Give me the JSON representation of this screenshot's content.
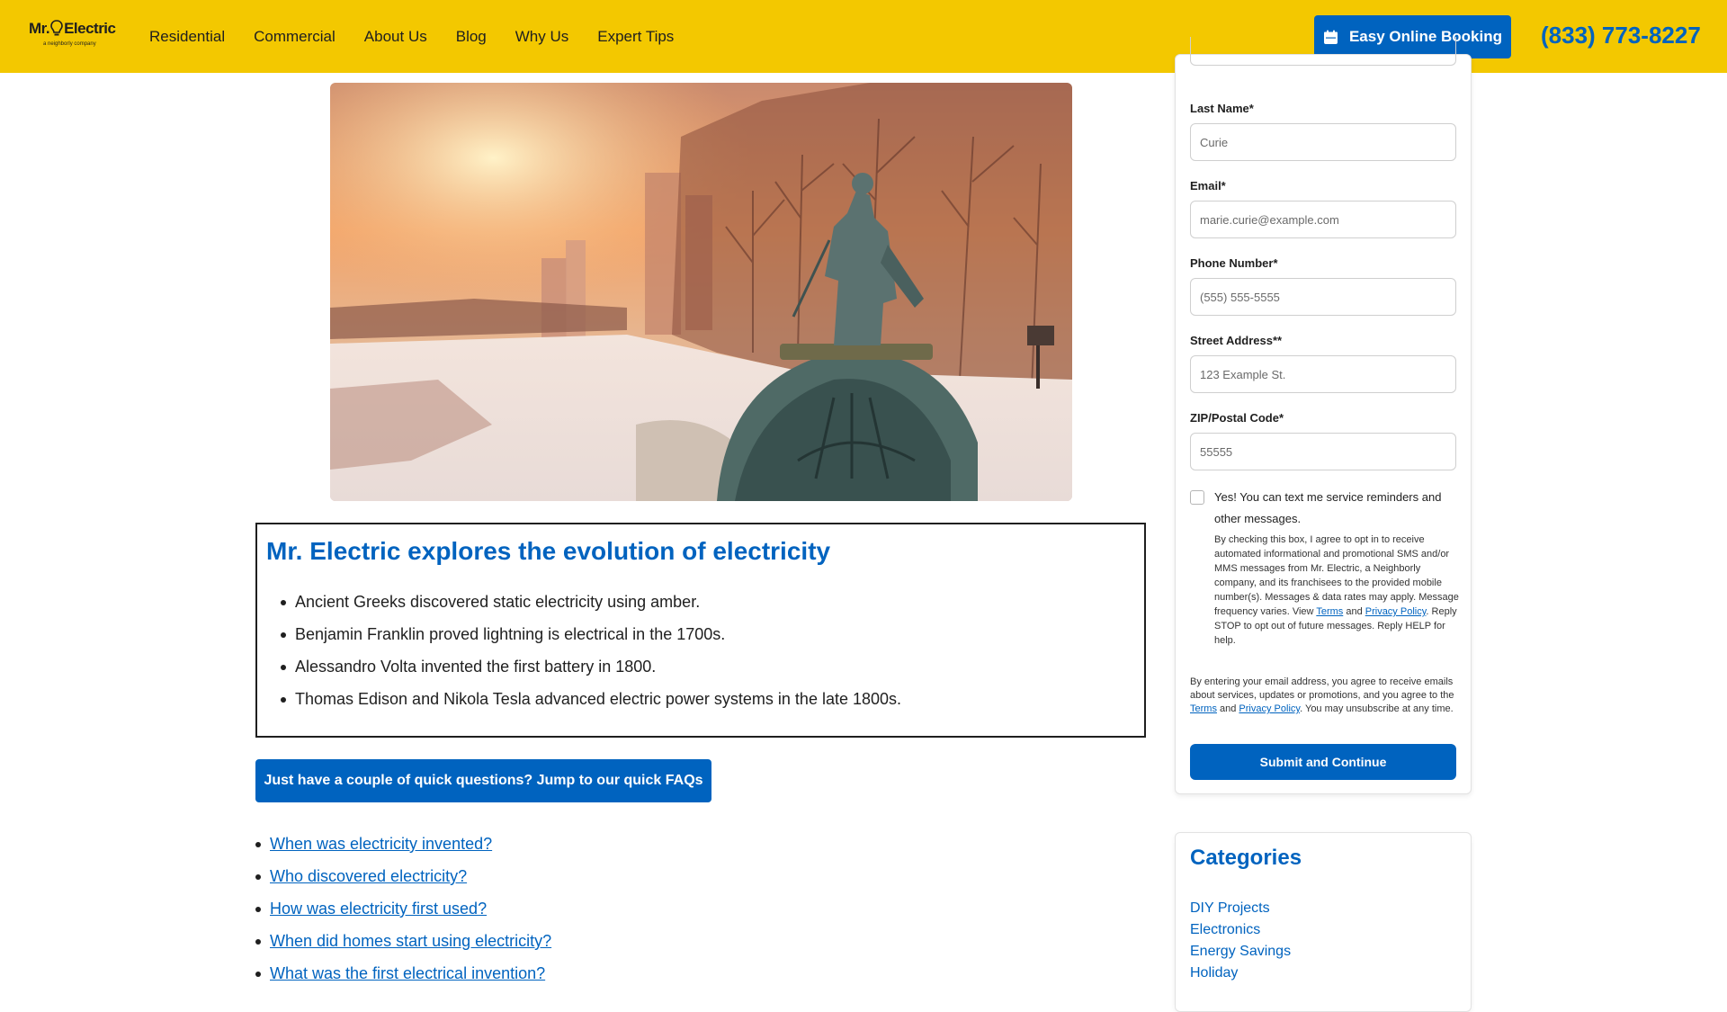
{
  "header": {
    "logo_text": "Mr. Electric",
    "logo_sub": "a neighborly company",
    "nav": [
      "Residential",
      "Commercial",
      "About Us",
      "Blog",
      "Why Us",
      "Expert Tips"
    ],
    "booking_label": "Easy Online Booking",
    "booking_icon": "calendar-icon",
    "phone": "(833) 773-8227",
    "bg_color": "#f3c800",
    "accent_color": "#0063bf"
  },
  "hero": {
    "image": "Statue of Nikola Tesla standing on a generator in snowy landscape at sunset"
  },
  "summary": {
    "title": "Mr. Electric explores the evolution of electricity",
    "items": [
      "Ancient Greeks discovered static electricity using amber.",
      "Benjamin Franklin proved lightning is electrical in the 1700s.",
      "Alessandro Volta invented the first battery in 1800.",
      "Thomas Edison and Nikola Tesla advanced electric power systems in the late 1800s."
    ]
  },
  "faq_button": "Just have a couple of quick questions? Jump to our quick FAQs",
  "faq_links": [
    "When was electricity invented?",
    "Who discovered electricity?",
    "How was electricity first used?",
    "When did homes start using electricity?",
    "What was the first electrical invention?"
  ],
  "form": {
    "last_name_label": "Last Name*",
    "last_name_placeholder": "Curie",
    "email_label": "Email*",
    "email_placeholder": "marie.curie@example.com",
    "phone_label": "Phone Number*",
    "phone_placeholder": "(555) 555-5555",
    "street_label": "Street Address**",
    "street_placeholder": "123 Example St.",
    "zip_label": "ZIP/Postal Code*",
    "zip_placeholder": "55555",
    "opt_in_label": "Yes! You can text me service reminders and other messages.",
    "opt_fine_a": "By checking this box, I agree to opt in to receive automated informational and promotional SMS and/or MMS messages from Mr. Electric, a Neighborly company, and its franchisees to the provided mobile number(s). Messages & data rates may apply. Message frequency varies. View ",
    "opt_fine_terms": "Terms",
    "opt_fine_and": " and ",
    "opt_fine_privacy": "Privacy Policy",
    "opt_fine_b": ". Reply STOP to opt out of future messages. Reply HELP for help.",
    "email_fine_a": "By entering your email address, you agree to receive emails about services, updates or promotions, and you agree to the ",
    "email_fine_terms": "Terms",
    "email_fine_and": " and ",
    "email_fine_privacy": "Privacy Policy",
    "email_fine_b": ". You may unsubscribe at any time.",
    "submit_label": "Submit and Continue"
  },
  "categories": {
    "title": "Categories",
    "items": [
      "DIY Projects",
      "Electronics",
      "Energy Savings",
      "Holiday"
    ]
  }
}
